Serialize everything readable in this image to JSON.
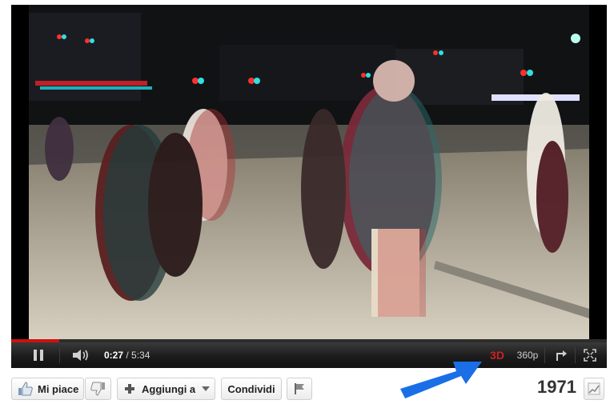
{
  "player": {
    "time_current": "0:27",
    "time_separator": " / ",
    "time_total": "5:34",
    "progress": 0.081,
    "btn_3d": "3D",
    "quality": "360p"
  },
  "actions": {
    "like_label": "Mi piace",
    "add_to_label": "Aggiungi a",
    "share_label": "Condividi"
  },
  "view_count": "1971",
  "icons": {
    "pause": "pause-icon",
    "volume": "speaker-icon",
    "popout": "popout-icon",
    "fullscreen": "fullscreen-icon",
    "like": "thumbs-up-icon",
    "dislike": "thumbs-down-icon",
    "add": "plus-icon",
    "dropdown": "chevron-down-icon",
    "flag": "flag-icon",
    "stats": "stats-chart-icon"
  },
  "colors": {
    "progress": "#cc1010",
    "accent_3d": "#cc2222",
    "annotation_arrow": "#1a6fe6"
  }
}
